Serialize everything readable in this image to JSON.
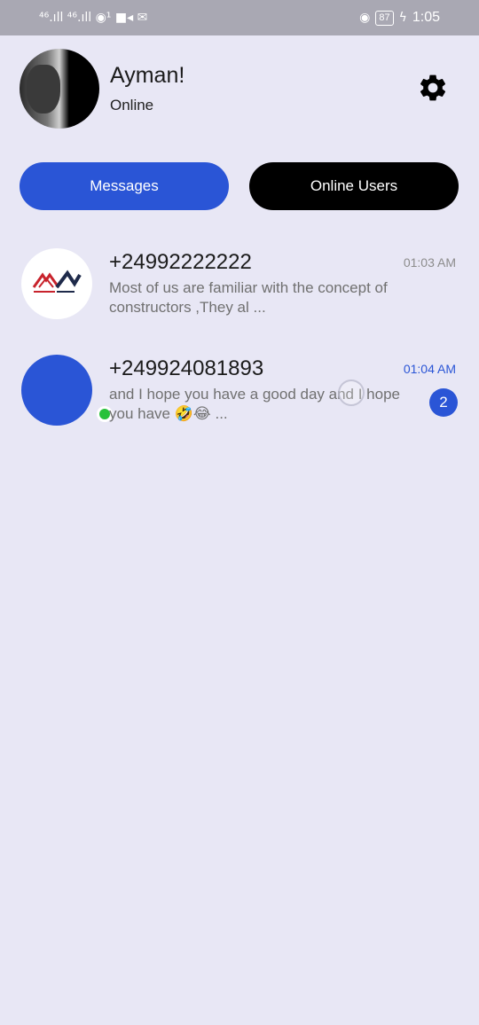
{
  "status_bar": {
    "left_indicators": "⁴⁶.ıll ⁴⁶.ıll ◉¹ ■◂ ✉",
    "battery": "87",
    "time": "1:05"
  },
  "profile": {
    "name": "Ayman!",
    "status": "Online",
    "settings_icon": "gear-icon"
  },
  "tabs": [
    {
      "label": "Messages",
      "active": true
    },
    {
      "label": "Online Users",
      "active": false
    }
  ],
  "conversations": [
    {
      "name": "+24992222222",
      "time": "01:03 AM",
      "preview": "Most of us are familiar with the concept of constructors ,They al ...",
      "online": true,
      "unread": null
    },
    {
      "name": "+249924081893",
      "time": "01:04 AM",
      "preview": "and I hope you have a good day and I hope you have 🤣😂 ...",
      "online": true,
      "unread": "2"
    }
  ],
  "colors": {
    "accent": "#2a55d6",
    "online": "#27c13a",
    "background": "#e8e7f5"
  }
}
